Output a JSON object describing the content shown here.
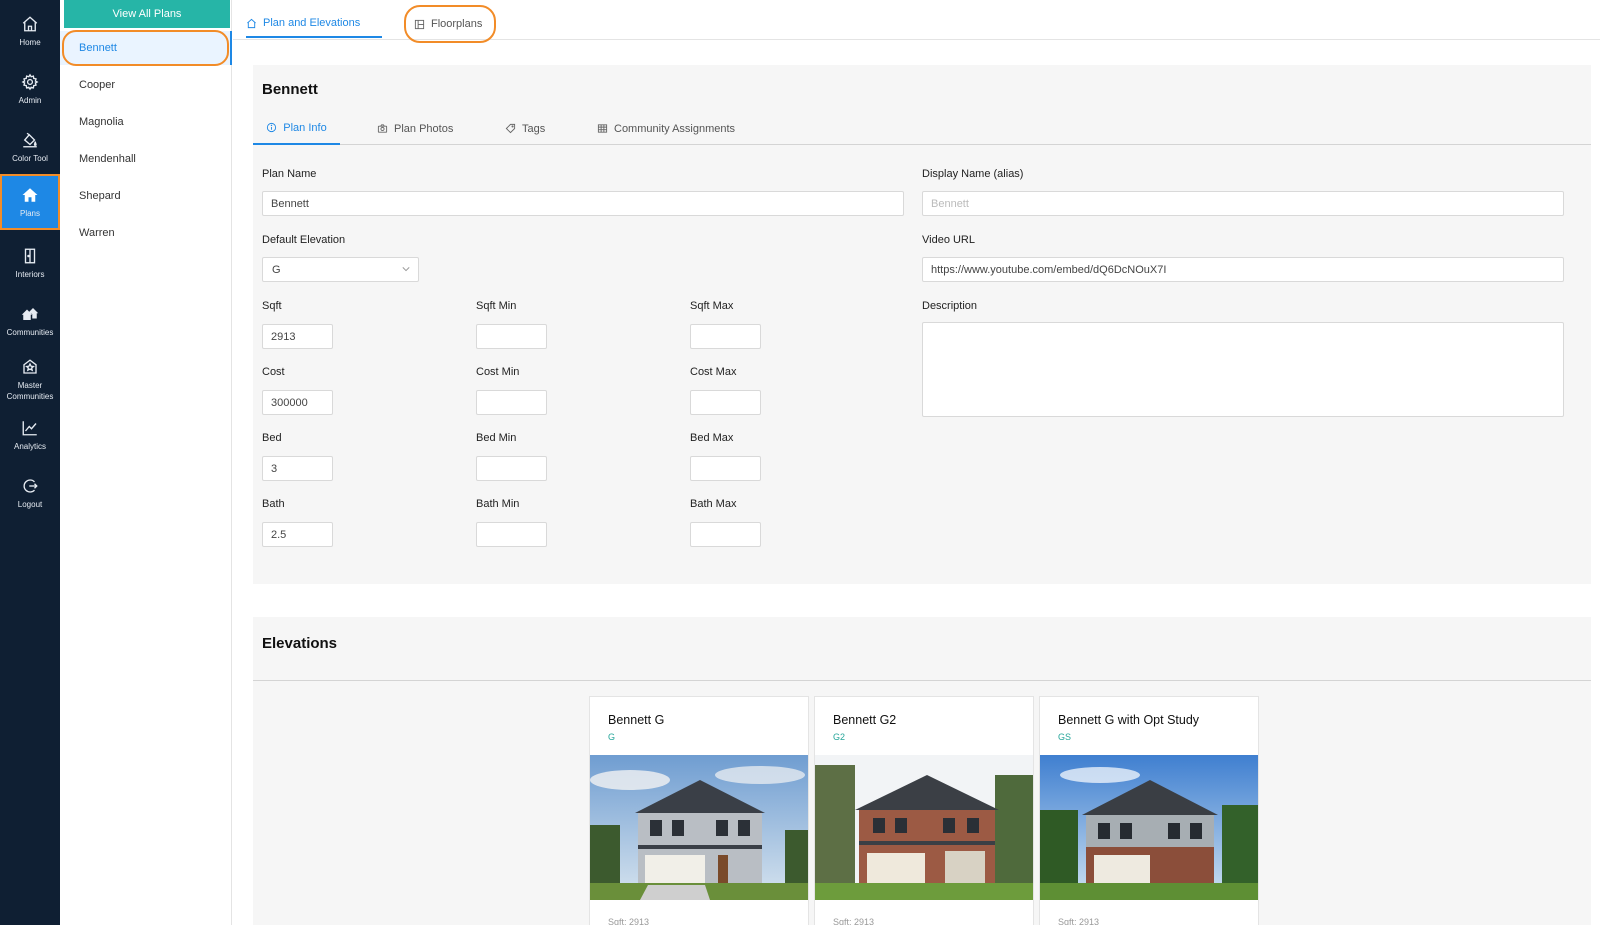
{
  "rail": [
    {
      "label": "Home",
      "icon": "home-icon"
    },
    {
      "label": "Admin",
      "icon": "gear-icon"
    },
    {
      "label": "Color Tool",
      "icon": "paint-bucket-icon"
    },
    {
      "label": "Plans",
      "icon": "house-icon"
    },
    {
      "label": "Interiors",
      "icon": "door-icon"
    },
    {
      "label": "Communities",
      "icon": "houses-icon"
    },
    {
      "label": "Master",
      "label2": "Communities",
      "icon": "badge-house-icon"
    },
    {
      "label": "Analytics",
      "icon": "chart-line-icon"
    },
    {
      "label": "Logout",
      "icon": "logout-icon"
    }
  ],
  "plans_list": {
    "view_all": "View All Plans",
    "items": [
      "Bennett",
      "Cooper",
      "Magnolia",
      "Mendenhall",
      "Shepard",
      "Warren"
    ],
    "selected": "Bennett"
  },
  "top_tabs": [
    {
      "label": "Plan and Elevations",
      "icon": "home-icon"
    },
    {
      "label": "Floorplans",
      "icon": "floorplan-icon"
    }
  ],
  "plan_panel": {
    "title": "Bennett",
    "tabs": [
      {
        "label": "Plan Info",
        "icon": "info-icon"
      },
      {
        "label": "Plan Photos",
        "icon": "camera-icon"
      },
      {
        "label": "Tags",
        "icon": "tag-icon"
      },
      {
        "label": "Community Assignments",
        "icon": "table-icon"
      }
    ],
    "form": {
      "plan_name_label": "Plan Name",
      "plan_name_value": "Bennett",
      "display_name_label": "Display Name (alias)",
      "display_name_placeholder": "Bennett",
      "default_elevation_label": "Default Elevation",
      "default_elevation_value": "G",
      "video_url_label": "Video URL",
      "video_url_value": "https://www.youtube.com/embed/dQ6DcNOuX7I",
      "description_label": "Description",
      "description_value": "",
      "sqft_label": "Sqft",
      "sqft_value": "2913",
      "sqft_min_label": "Sqft Min",
      "sqft_min_value": "",
      "sqft_max_label": "Sqft Max",
      "sqft_max_value": "",
      "cost_label": "Cost",
      "cost_value": "300000",
      "cost_min_label": "Cost Min",
      "cost_min_value": "",
      "cost_max_label": "Cost Max",
      "cost_max_value": "",
      "bed_label": "Bed",
      "bed_value": "3",
      "bed_min_label": "Bed Min",
      "bed_min_value": "",
      "bed_max_label": "Bed Max",
      "bed_max_value": "",
      "bath_label": "Bath",
      "bath_value": "2.5",
      "bath_min_label": "Bath Min",
      "bath_min_value": "",
      "bath_max_label": "Bath Max",
      "bath_max_value": ""
    }
  },
  "elevations": {
    "title": "Elevations",
    "cards": [
      {
        "name": "Bennett G",
        "code": "G",
        "meta": "Sqft: 2913"
      },
      {
        "name": "Bennett G2",
        "code": "G2",
        "meta": "Sqft: 2913"
      },
      {
        "name": "Bennett G with Opt Study",
        "code": "GS",
        "meta": "Sqft: 2913"
      }
    ]
  },
  "colors": {
    "rail_bg": "#0f1f33",
    "accent": "#1e88e5",
    "teal": "#26b5a7",
    "highlight": "#f28c28",
    "panel_bg": "#f6f6f6"
  }
}
